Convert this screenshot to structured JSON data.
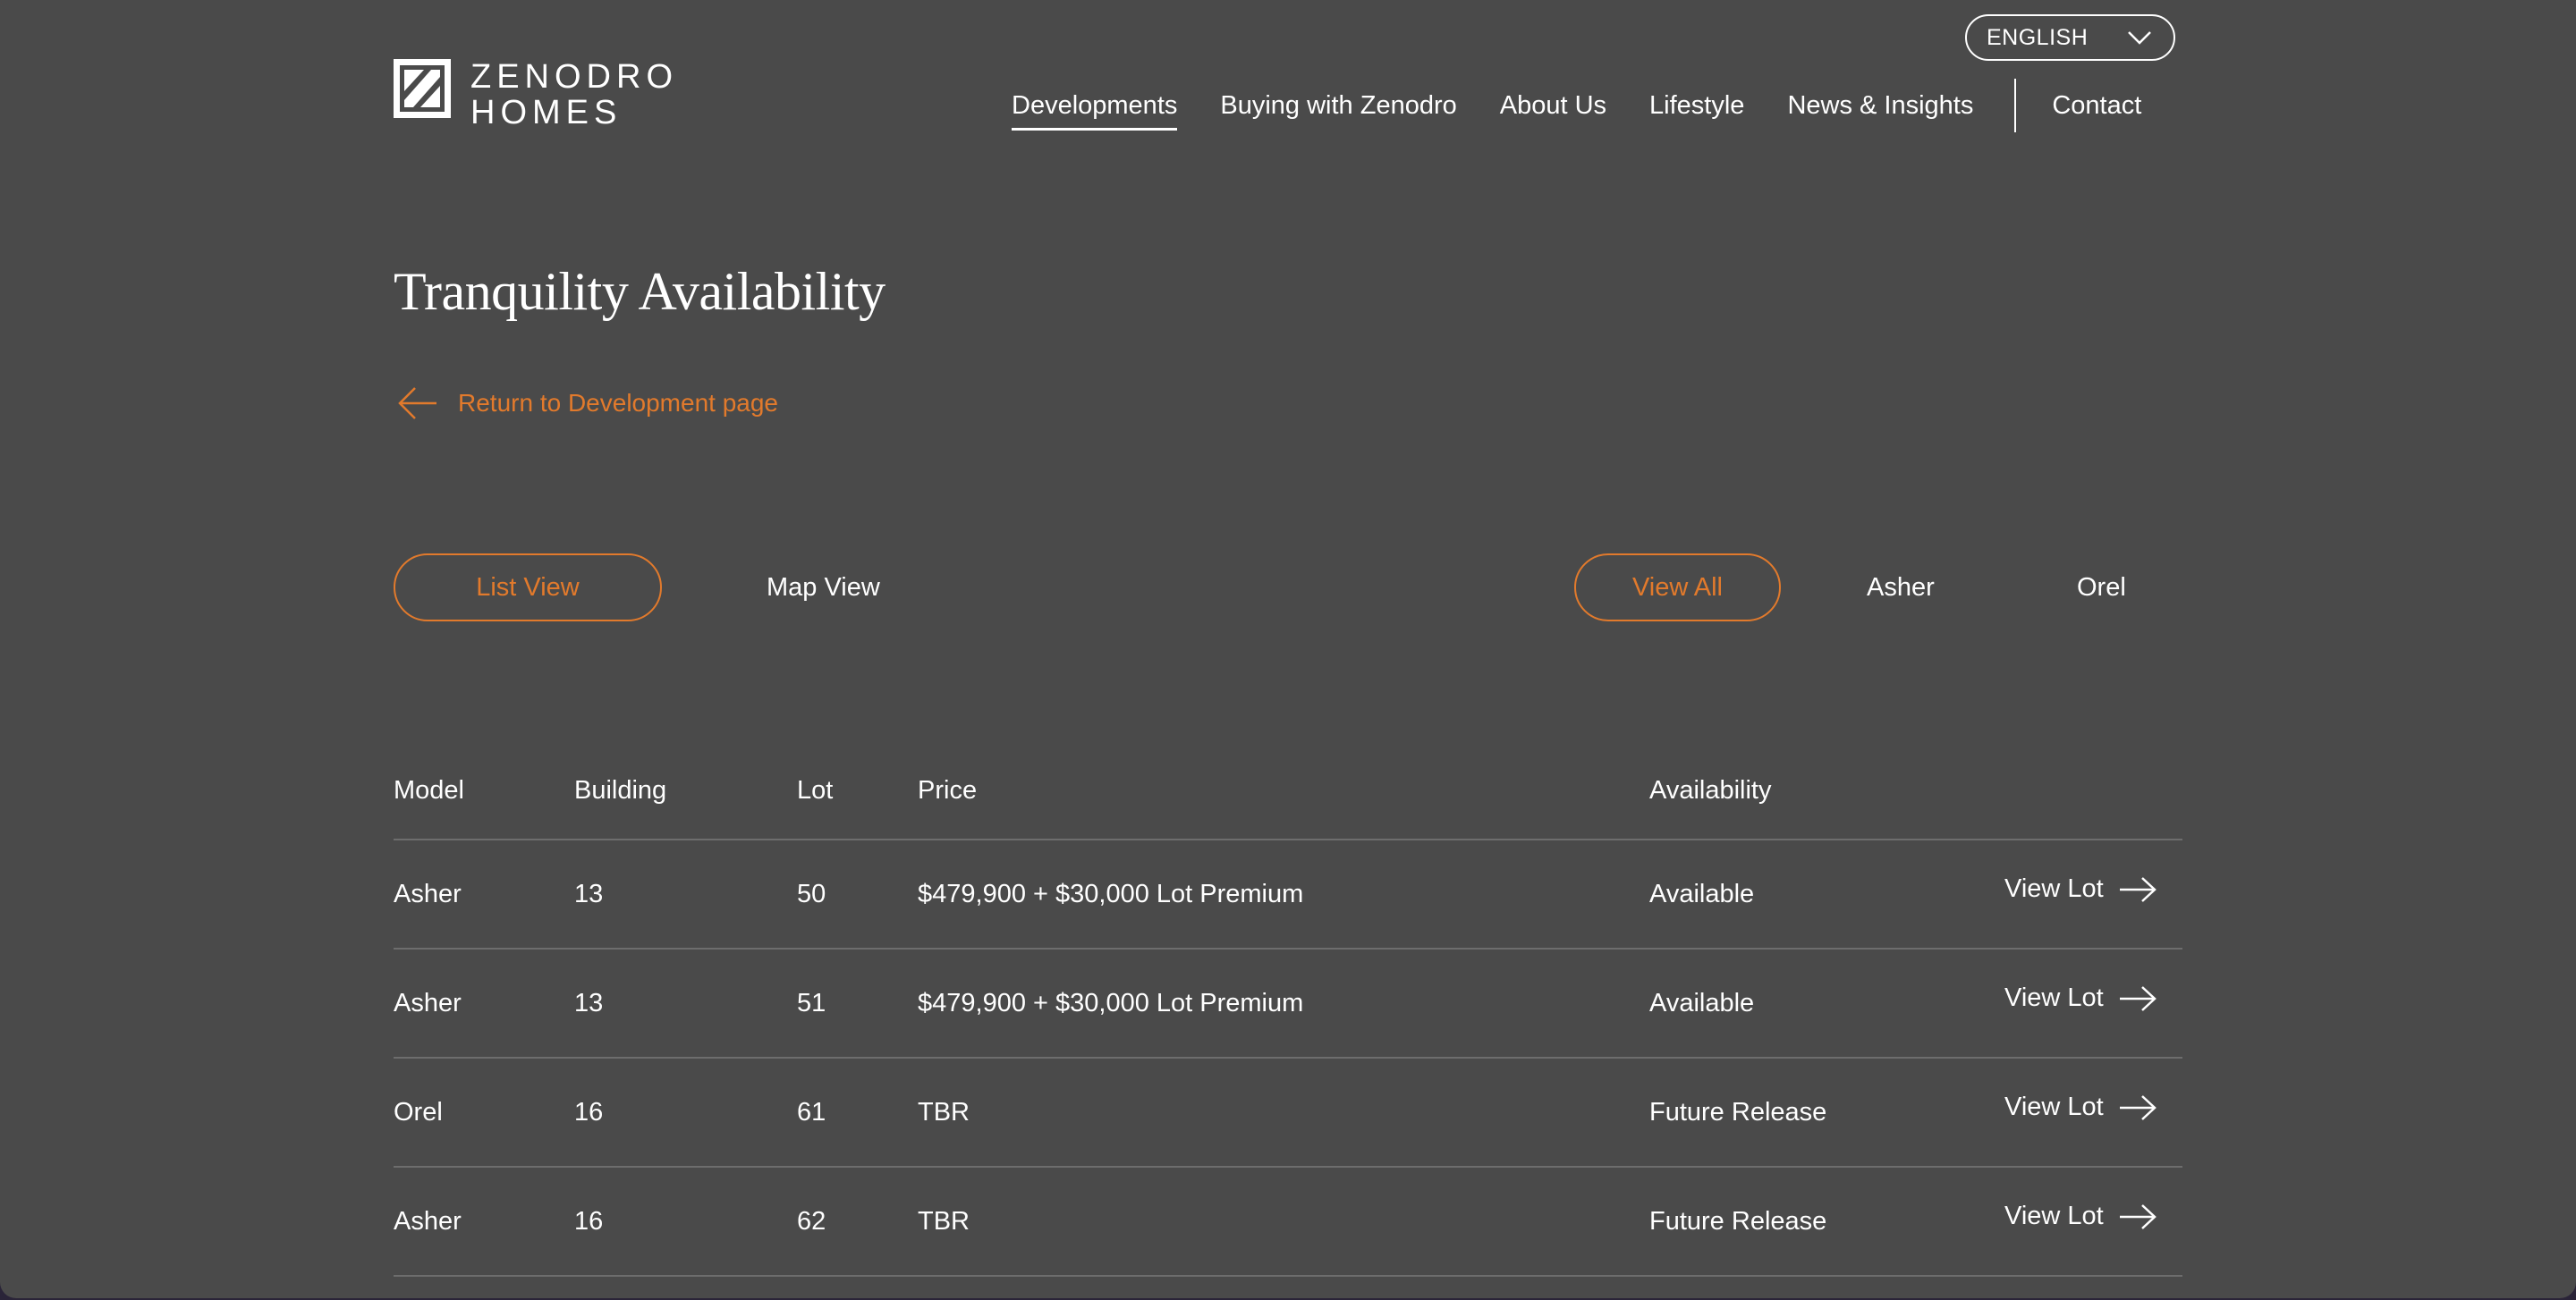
{
  "language": {
    "label": "ENGLISH",
    "icon": "chevron-down-icon"
  },
  "logo": {
    "line1": "ZENODRO",
    "line2": "HOMES",
    "icon": "zenodro-logo-mark"
  },
  "nav": {
    "items": [
      "Developments",
      "Buying with Zenodro",
      "About Us",
      "Lifestyle",
      "News & Insights"
    ],
    "active": "Developments",
    "contact": "Contact"
  },
  "page": {
    "title": "Tranquility Availability",
    "back_link": "Return to Development page"
  },
  "views": {
    "list": "List View",
    "map": "Map View",
    "selected": "List View"
  },
  "filters": {
    "all": "View All",
    "asher": "Asher",
    "orel": "Orel",
    "selected": "View All"
  },
  "table": {
    "headers": {
      "model": "Model",
      "building": "Building",
      "lot": "Lot",
      "price": "Price",
      "availability": "Availability"
    },
    "rows": [
      {
        "model": "Asher",
        "building": "13",
        "lot": "50",
        "price": "$479,900 + $30,000 Lot Premium",
        "availability": "Available",
        "action": "View Lot"
      },
      {
        "model": "Asher",
        "building": "13",
        "lot": "51",
        "price": "$479,900 + $30,000 Lot Premium",
        "availability": "Available",
        "action": "View Lot"
      },
      {
        "model": "Orel",
        "building": "16",
        "lot": "61",
        "price": "TBR",
        "availability": "Future Release",
        "action": "View Lot"
      },
      {
        "model": "Asher",
        "building": "16",
        "lot": "62",
        "price": "TBR",
        "availability": "Future Release",
        "action": "View Lot"
      }
    ]
  },
  "colors": {
    "background": "#4a4a4a",
    "accent": "#e27a2c",
    "text": "#ffffff",
    "divider": "#6d6d6d"
  }
}
